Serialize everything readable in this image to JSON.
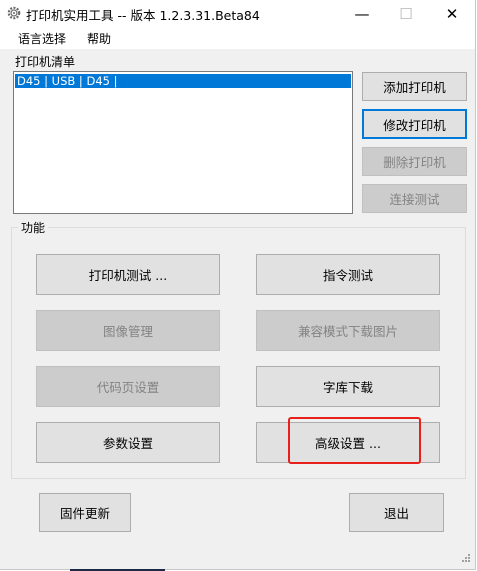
{
  "window": {
    "title": "打印机实用工具 -- 版本 1.2.3.31.Beta84",
    "icon": "gear-icon",
    "controls": {
      "minimize": "—",
      "maximize": "☐",
      "close": "✕"
    }
  },
  "menu": {
    "language": "语言选择",
    "help": "帮助"
  },
  "printer_list": {
    "label": "打印机清单",
    "items": [
      "D45 | USB | D45 |"
    ]
  },
  "side_buttons": {
    "add": "添加打印机",
    "modify": "修改打印机",
    "delete": "删除打印机",
    "test_connection": "连接测试"
  },
  "functions": {
    "title": "功能",
    "printer_test": "打印机测试 ...",
    "command_test": "指令测试",
    "image_manage": "图像管理",
    "compat_download": "兼容模式下载图片",
    "codepage": "代码页设置",
    "font_download": "字库下载",
    "params": "参数设置",
    "advanced": "高级设置 ..."
  },
  "footer": {
    "firmware": "固件更新",
    "exit": "退出"
  },
  "colors": {
    "selection": "#0078d7",
    "focus_border": "#0078d7",
    "highlight_annotation": "#e8201c"
  }
}
